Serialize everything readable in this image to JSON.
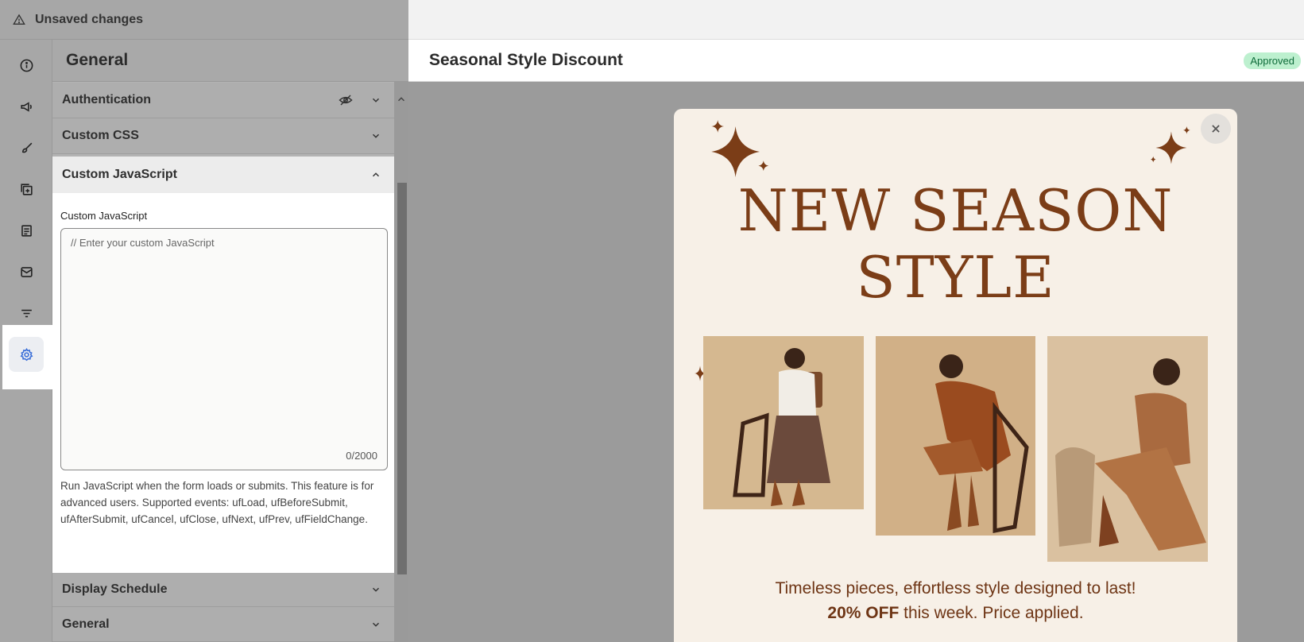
{
  "topbar": {
    "status": "Unsaved changes",
    "icon": "warning-icon"
  },
  "rail": [
    {
      "name": "info-icon"
    },
    {
      "name": "megaphone-icon"
    },
    {
      "name": "brush-icon"
    },
    {
      "name": "add-layers-icon"
    },
    {
      "name": "form-icon"
    },
    {
      "name": "mail-icon"
    },
    {
      "name": "filter-icon"
    },
    {
      "name": "gear-icon",
      "active": true
    }
  ],
  "panel": {
    "title": "General",
    "sections": {
      "authentication": "Authentication",
      "custom_css": "Custom CSS",
      "custom_js": "Custom JavaScript",
      "display_schedule": "Display Schedule",
      "general": "General"
    },
    "js_field": {
      "label": "Custom JavaScript",
      "placeholder": "// Enter your custom JavaScript",
      "value": "",
      "counter": "0/2000",
      "help": "Run JavaScript when the form loads or submits. This feature is for advanced users. Supported events: ufLoad, ufBeforeSubmit, ufAfterSubmit, ufCancel, ufClose, ufNext, ufPrev, ufFieldChange."
    }
  },
  "preview": {
    "title": "Seasonal Style Discount",
    "status": "Approved",
    "colors": {
      "accent": "#7b3d17",
      "popup_bg": "#f7f0e7",
      "badge_bg": "#bdf0cf"
    },
    "popup": {
      "headline_line1": "NEW SEASON",
      "headline_line2": "STYLE",
      "tagline": "Timeless pieces, effortless style designed to last!",
      "offer_bold": "20% OFF",
      "offer_rest": " this week. Price applied."
    }
  }
}
